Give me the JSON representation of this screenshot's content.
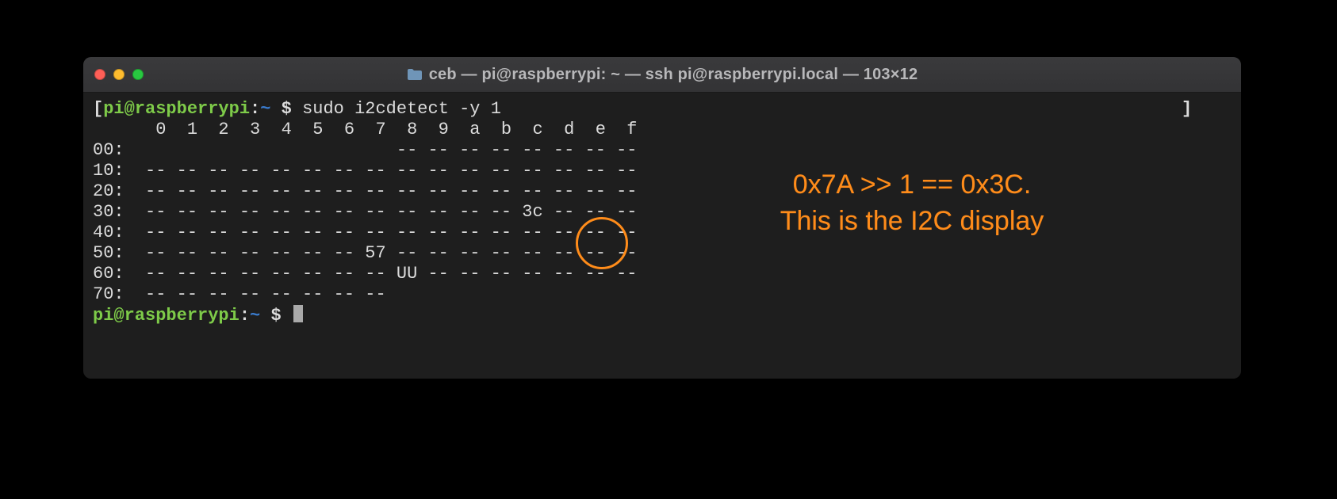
{
  "window": {
    "title": "ceb — pi@raspberrypi: ~ — ssh pi@raspberrypi.local — 103×12",
    "traffic_lights": {
      "close": "red",
      "minimize": "yellow",
      "zoom": "green"
    }
  },
  "prompt": {
    "open": "[",
    "user_host": "pi@raspberrypi",
    "colon": ":",
    "cwd": "~",
    "dollar": " $ ",
    "close": "]"
  },
  "command": "sudo i2cdetect -y 1",
  "i2c": {
    "columns": [
      "0",
      "1",
      "2",
      "3",
      "4",
      "5",
      "6",
      "7",
      "8",
      "9",
      "a",
      "b",
      "c",
      "d",
      "e",
      "f"
    ],
    "rows": [
      {
        "label": "00:",
        "cells": [
          "",
          "",
          "",
          "",
          "",
          "",
          "",
          "",
          "--",
          "--",
          "--",
          "--",
          "--",
          "--",
          "--",
          "--"
        ]
      },
      {
        "label": "10:",
        "cells": [
          "--",
          "--",
          "--",
          "--",
          "--",
          "--",
          "--",
          "--",
          "--",
          "--",
          "--",
          "--",
          "--",
          "--",
          "--",
          "--"
        ]
      },
      {
        "label": "20:",
        "cells": [
          "--",
          "--",
          "--",
          "--",
          "--",
          "--",
          "--",
          "--",
          "--",
          "--",
          "--",
          "--",
          "--",
          "--",
          "--",
          "--"
        ]
      },
      {
        "label": "30:",
        "cells": [
          "--",
          "--",
          "--",
          "--",
          "--",
          "--",
          "--",
          "--",
          "--",
          "--",
          "--",
          "--",
          "3c",
          "--",
          "--",
          "--"
        ]
      },
      {
        "label": "40:",
        "cells": [
          "--",
          "--",
          "--",
          "--",
          "--",
          "--",
          "--",
          "--",
          "--",
          "--",
          "--",
          "--",
          "--",
          "--",
          "--",
          "--"
        ]
      },
      {
        "label": "50:",
        "cells": [
          "--",
          "--",
          "--",
          "--",
          "--",
          "--",
          "--",
          "57",
          "--",
          "--",
          "--",
          "--",
          "--",
          "--",
          "--",
          "--"
        ]
      },
      {
        "label": "60:",
        "cells": [
          "--",
          "--",
          "--",
          "--",
          "--",
          "--",
          "--",
          "--",
          "UU",
          "--",
          "--",
          "--",
          "--",
          "--",
          "--",
          "--"
        ]
      },
      {
        "label": "70:",
        "cells": [
          "--",
          "--",
          "--",
          "--",
          "--",
          "--",
          "--",
          "--",
          "",
          "",
          "",
          "",
          "",
          "",
          "",
          ""
        ]
      }
    ]
  },
  "annotation": {
    "line1": "0x7A >> 1 == 0x3C.",
    "line2": "This is the I2C display"
  }
}
